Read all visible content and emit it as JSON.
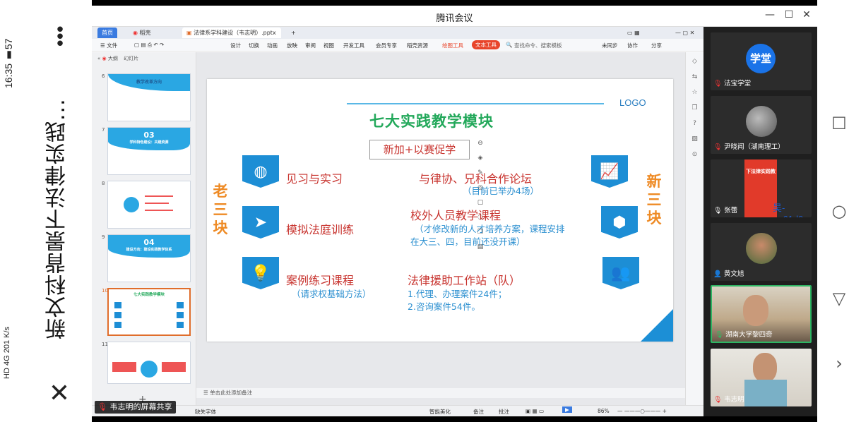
{
  "android": {
    "time": "16:35",
    "battery": "57",
    "net_speed": "201 K/s",
    "signal": "4G",
    "hd": "HD",
    "page_title": "新文科背景下法律实践...",
    "more": "⋮",
    "close": "✕"
  },
  "meeting": {
    "title": "腾讯会议",
    "min": "—",
    "max": "☐",
    "close": "✕",
    "share_label": "韦志明的屏幕共享"
  },
  "wps": {
    "tabs": [
      {
        "label": "首页"
      },
      {
        "label": "稻壳"
      },
      {
        "label": "法律系学科建设（韦志明）.pptx"
      },
      {
        "label": "+"
      }
    ],
    "menu": [
      "文件",
      "设计",
      "切换",
      "动画",
      "放映",
      "审阅",
      "视图",
      "开发工具",
      "会员专享",
      "稻壳资源",
      "绘图工具",
      "文本工具"
    ],
    "search_placeholder": "查找命令、搜索模板",
    "right_menu": [
      "未同步",
      "协作",
      "分享"
    ],
    "panel_tabs": [
      "大纲",
      "幻灯片"
    ],
    "thumbnails": [
      {
        "num": "6",
        "title": "教学改革方向",
        "sub": ""
      },
      {
        "num": "7",
        "title": "03",
        "sub": "学科特色建设：共建资源"
      },
      {
        "num": "8",
        "title": "",
        "sub": ""
      },
      {
        "num": "9",
        "title": "04",
        "sub": "建设方向：建设实践教学体系"
      },
      {
        "num": "10",
        "title": "七大实践教学模块",
        "sub": ""
      },
      {
        "num": "11",
        "title": "",
        "sub": ""
      }
    ],
    "notes_placeholder": "单击此处添加备注",
    "status": {
      "font_missing": "缺失字体",
      "beautify": "智能美化",
      "notes": "备注",
      "comments": "批注",
      "zoom": "86%"
    }
  },
  "slide": {
    "logo": "LOGO",
    "title": "七大实践教学模块",
    "subtitle": "新加+以赛促学",
    "left_label": "老三块",
    "right_label": "新三块",
    "modules_left": [
      {
        "label": "见习与实习",
        "note": "",
        "icon": "globe-icon"
      },
      {
        "label": "模拟法庭训练",
        "note": "",
        "icon": "paper-plane-icon"
      },
      {
        "label": "案例练习课程",
        "note": "（请求权基础方法）",
        "icon": "lightbulb-icon"
      }
    ],
    "modules_mid": [
      {
        "label": "与律协、兄科合作论坛",
        "note": "（目前已举办4场）"
      },
      {
        "label": "校外人员教学课程",
        "note": "（才修改新的人才培养方案，课程安排",
        "note2": "在大三、四，目前还没开课）"
      },
      {
        "label": "法律援助工作站（队）",
        "note": "1.代理、办理案件24件；",
        "note2": "2.咨询案件54件。"
      }
    ],
    "modules_right_icons": [
      "trend-chart-icon",
      "cube-icon",
      "group-icon"
    ]
  },
  "participants": [
    {
      "name": "法宝学堂",
      "avatar_text": "学堂",
      "type": "avatar"
    },
    {
      "name": "尹晓闻（湖南理工）",
      "type": "photo"
    },
    {
      "name": "张蕾",
      "type": "poster",
      "poster_text": "下法律实践教",
      "overlay": "吴-u_61d9"
    },
    {
      "name": "黄文旭",
      "type": "photo"
    },
    {
      "name": "湖南大学黎四奇",
      "type": "camera",
      "active": true
    },
    {
      "name": "韦志明",
      "type": "camera"
    }
  ],
  "colors": {
    "slide_blue": "#1d8ed5",
    "slide_red": "#c8342f",
    "slide_green": "#22a85a",
    "slide_orange": "#ee8a24",
    "active_border": "#2eb563"
  }
}
